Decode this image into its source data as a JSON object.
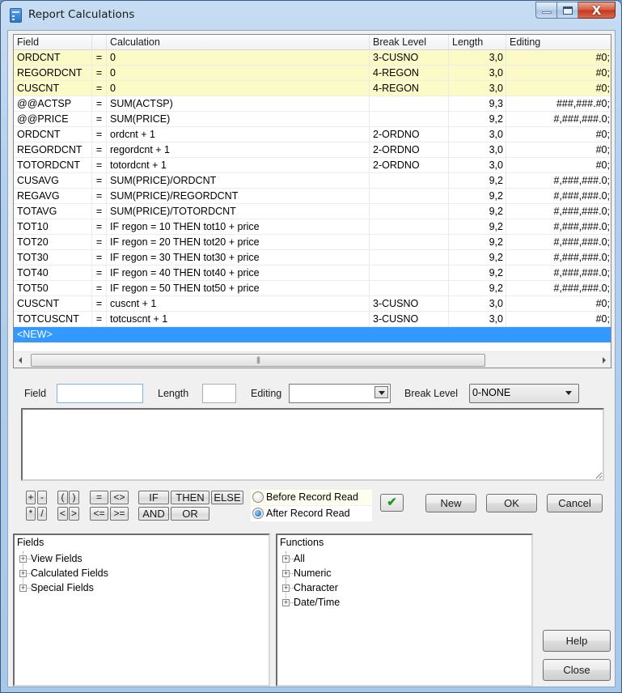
{
  "window": {
    "title": "Report Calculations",
    "controls": {
      "minimize": "minimize",
      "maximize": "maximize",
      "close": "X"
    }
  },
  "grid": {
    "columns": [
      "Field",
      "",
      "Calculation",
      "Break Level",
      "Length",
      "Editing"
    ],
    "rows": [
      {
        "field": "ORDCNT",
        "eq": "=",
        "calc": "0",
        "break": "3-CUSNO",
        "length": "3,0",
        "editing": "#0;",
        "highlight": true
      },
      {
        "field": "REGORDCNT",
        "eq": "=",
        "calc": "0",
        "break": "4-REGON",
        "length": "3,0",
        "editing": "#0;",
        "highlight": true
      },
      {
        "field": "CUSCNT",
        "eq": "=",
        "calc": "0",
        "break": "4-REGON",
        "length": "3,0",
        "editing": "#0;",
        "highlight": true
      },
      {
        "field": "@@ACTSP",
        "eq": "=",
        "calc": "SUM(ACTSP)",
        "break": "",
        "length": "9,3",
        "editing": "###,###.#0;",
        "highlight": false
      },
      {
        "field": "@@PRICE",
        "eq": "=",
        "calc": "SUM(PRICE)",
        "break": "",
        "length": "9,2",
        "editing": "#,###,###.0;",
        "highlight": false
      },
      {
        "field": "ORDCNT",
        "eq": "=",
        "calc": "ordcnt + 1",
        "break": "2-ORDNO",
        "length": "3,0",
        "editing": "#0;",
        "highlight": false
      },
      {
        "field": "REGORDCNT",
        "eq": "=",
        "calc": "regordcnt + 1",
        "break": "2-ORDNO",
        "length": "3,0",
        "editing": "#0;",
        "highlight": false
      },
      {
        "field": "TOTORDCNT",
        "eq": "=",
        "calc": "totordcnt + 1",
        "break": "2-ORDNO",
        "length": "3,0",
        "editing": "#0;",
        "highlight": false
      },
      {
        "field": "CUSAVG",
        "eq": "=",
        "calc": "SUM(PRICE)/ORDCNT",
        "break": "",
        "length": "9,2",
        "editing": "#,###,###.0;",
        "highlight": false
      },
      {
        "field": "REGAVG",
        "eq": "=",
        "calc": "SUM(PRICE)/REGORDCNT",
        "break": "",
        "length": "9,2",
        "editing": "#,###,###.0;",
        "highlight": false
      },
      {
        "field": "TOTAVG",
        "eq": "=",
        "calc": "SUM(PRICE)/TOTORDCNT",
        "break": "",
        "length": "9,2",
        "editing": "#,###,###.0;",
        "highlight": false
      },
      {
        "field": "TOT10",
        "eq": "=",
        "calc": "IF regon = 10 THEN tot10 + price",
        "break": "",
        "length": "9,2",
        "editing": "#,###,###.0;",
        "highlight": false
      },
      {
        "field": "TOT20",
        "eq": "=",
        "calc": "IF regon = 20 THEN tot20 + price",
        "break": "",
        "length": "9,2",
        "editing": "#,###,###.0;",
        "highlight": false
      },
      {
        "field": "TOT30",
        "eq": "=",
        "calc": "IF regon = 30 THEN tot30 + price",
        "break": "",
        "length": "9,2",
        "editing": "#,###,###.0;",
        "highlight": false
      },
      {
        "field": "TOT40",
        "eq": "=",
        "calc": "IF regon = 40 THEN tot40 + price",
        "break": "",
        "length": "9,2",
        "editing": "#,###,###.0;",
        "highlight": false
      },
      {
        "field": "TOT50",
        "eq": "=",
        "calc": "IF regon = 50 THEN tot50 + price",
        "break": "",
        "length": "9,2",
        "editing": "#,###,###.0;",
        "highlight": false
      },
      {
        "field": "CUSCNT",
        "eq": "=",
        "calc": "cuscnt + 1",
        "break": "3-CUSNO",
        "length": "3,0",
        "editing": "#0;",
        "highlight": false
      },
      {
        "field": "TOTCUSCNT",
        "eq": "=",
        "calc": "totcuscnt + 1",
        "break": "3-CUSNO",
        "length": "3,0",
        "editing": "#0;",
        "highlight": false
      }
    ],
    "new_row_label": "<NEW>",
    "scroll_thumb_grip": "|||"
  },
  "editor": {
    "field_label": "Field",
    "field_value": "",
    "length_label": "Length",
    "length_value": "",
    "editing_label": "Editing",
    "editing_value": "",
    "break_level_label": "Break Level",
    "break_level_value": "0-NONE",
    "expression_value": ""
  },
  "operators": {
    "plus": "+",
    "minus": "-",
    "lparen": "(",
    "rparen": ")",
    "equals": "=",
    "not_equal": "<>",
    "multiply": "*",
    "divide": "/",
    "less": "<",
    "greater": ">",
    "less_equal": "<=",
    "greater_equal": ">=",
    "if": "IF",
    "then": "THEN",
    "else": "ELSE",
    "and": "AND",
    "or": "OR"
  },
  "timing": {
    "before_label": "Before Record Read",
    "after_label": "After Record Read",
    "selected": "after"
  },
  "buttons": {
    "apply": "✔",
    "new": "New",
    "ok": "OK",
    "cancel": "Cancel",
    "help": "Help",
    "close": "Close"
  },
  "fields_tree": {
    "title": "Fields",
    "items": [
      "View Fields",
      "Calculated Fields",
      "Special Fields"
    ]
  },
  "functions_tree": {
    "title": "Functions",
    "items": [
      "All",
      "Numeric",
      "Character",
      "Date/Time"
    ]
  }
}
